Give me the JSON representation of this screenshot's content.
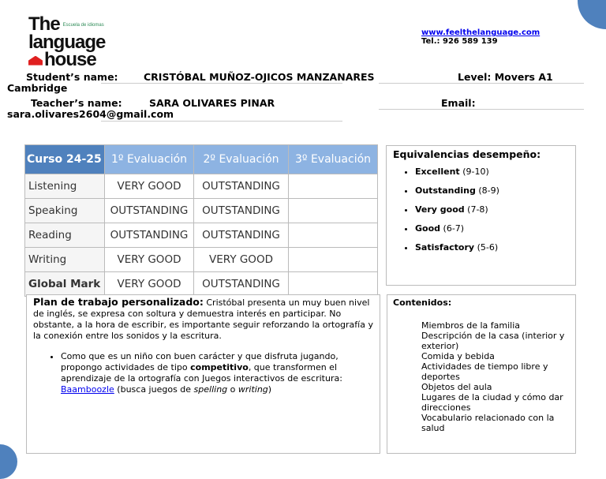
{
  "header": {
    "logo_the": "The",
    "logo_sub": "Escuela de idiomas",
    "logo_language": "language",
    "logo_house": "house",
    "website": "www.feelthelanguage.com",
    "phone": "Tel.: 926 589 139"
  },
  "student": {
    "label": "Student’s name:",
    "name": "CRISTÓBAL MUÑOZ-OJICOS MANZANARES",
    "level_label": "Level: Movers A1",
    "level_cont": "Cambridge"
  },
  "teacher": {
    "label": "Teacher’s name:",
    "name": "SARA OLIVARES PINAR",
    "email_label": "Email:",
    "email": "sara.olivares2604@gmail.com"
  },
  "grades": {
    "headers": [
      "Curso 24-25",
      "1º Evaluación",
      "2º Evaluación",
      "3º Evaluación"
    ],
    "rows": [
      {
        "skill": "Listening",
        "e1": "VERY GOOD",
        "e2": "OUTSTANDING",
        "e3": ""
      },
      {
        "skill": "Speaking",
        "e1": "OUTSTANDING",
        "e2": "OUTSTANDING",
        "e3": ""
      },
      {
        "skill": "Reading",
        "e1": "OUTSTANDING",
        "e2": "OUTSTANDING",
        "e3": ""
      },
      {
        "skill": "Writing",
        "e1": "VERY GOOD",
        "e2": "VERY GOOD",
        "e3": ""
      },
      {
        "skill": "Global Mark",
        "e1": "VERY GOOD",
        "e2": "OUTSTANDING",
        "e3": ""
      }
    ]
  },
  "equivalencias": {
    "title": "Equivalencias desempeño:",
    "items": [
      {
        "label": "Excellent",
        "range": "(9-10)"
      },
      {
        "label": "Outstanding",
        "range": "(8-9)"
      },
      {
        "label": "Very good",
        "range": "(7-8)"
      },
      {
        "label": "Good",
        "range": "(6-7)"
      },
      {
        "label": "Satisfactory",
        "range": "(5-6)"
      }
    ]
  },
  "plan": {
    "title": "Plan de trabajo personalizado:",
    "text": "Cristóbal presenta un muy buen nivel de inglés, se expresa con soltura y demuestra interés en participar. No obstante, a la hora de escribir, es importante seguir reforzando la ortografía y la conexión entre los sonidos y la escritura.",
    "bullet_a": "Como que es un niño con buen carácter y que disfruta jugando, propongo actividades de tipo ",
    "bullet_bold": "competitivo",
    "bullet_b": ", que transformen el aprendizaje de la ortografía con Juegos interactivos de escritura: ",
    "link": "Baamboozle",
    "bullet_c": " (busca juegos de ",
    "em1": "spelling",
    "bullet_d": " o ",
    "em2": "writing",
    "bullet_e": ")"
  },
  "contenidos": {
    "title": "Contenidos:",
    "items": [
      "Miembros de la familia",
      "Descripción de la casa (interior y exterior)",
      "Comida y bebida",
      "Actividades de tiempo libre y deportes",
      "Objetos del aula",
      "Lugares de la ciudad y cómo dar direcciones",
      "Vocabulario relacionado con la salud"
    ]
  }
}
